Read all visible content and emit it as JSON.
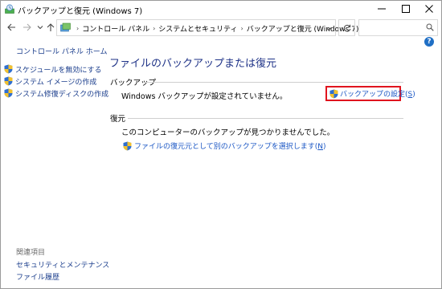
{
  "window": {
    "title": "バックアップと復元 (Windows 7)"
  },
  "address": {
    "crumbs": [
      "コントロール パネル",
      "システムとセキュリティ",
      "バックアップと復元 (Windows 7)"
    ],
    "search_placeholder": ""
  },
  "left_pane": {
    "home": "コントロール パネル ホーム",
    "tasks": [
      {
        "label": "スケジュールを無効にする"
      },
      {
        "label": "システム イメージの作成"
      },
      {
        "label": "システム修復ディスクの作成"
      }
    ],
    "related_heading": "関連項目",
    "related_links": [
      {
        "label": "セキュリティとメンテナンス"
      },
      {
        "label": "ファイル履歴"
      }
    ]
  },
  "main": {
    "title": "ファイルのバックアップまたは復元",
    "backup": {
      "heading": "バックアップ",
      "status": "Windows バックアップが設定されていません。",
      "setup_label": "バックアップの設定(",
      "setup_key": "S",
      "setup_close": ")"
    },
    "restore": {
      "heading": "復元",
      "status": "このコンピューターのバックアップが見つかりませんでした。",
      "link_label": "ファイルの復元元として別のバックアップを選択します(",
      "link_key": "N",
      "link_close": ")"
    }
  },
  "colors": {
    "link": "#1a56c4",
    "title": "#1e3287",
    "highlight_border": "#e0141e"
  }
}
